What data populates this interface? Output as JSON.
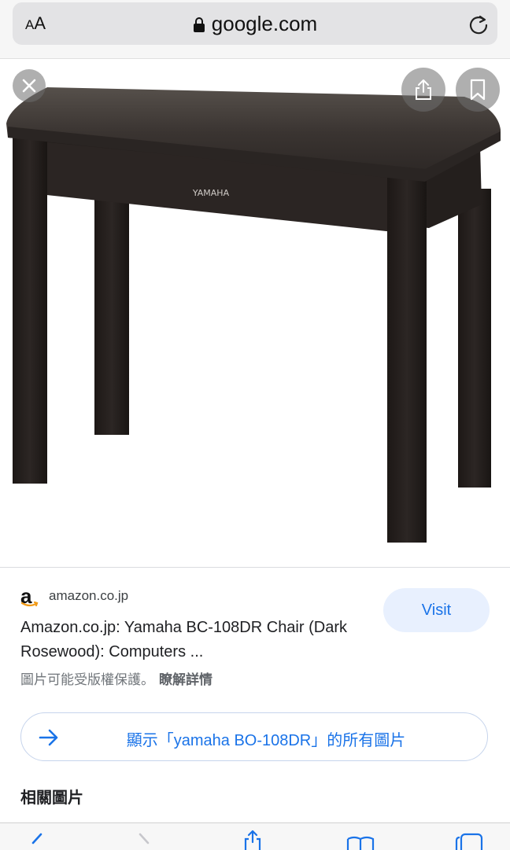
{
  "browser": {
    "text_size_label_small": "A",
    "text_size_label_large": "A",
    "url": "google.com"
  },
  "image_viewer": {
    "product_image": "yamaha-piano-bench",
    "brand_text": "YAMAHA"
  },
  "result": {
    "source_logo": "a",
    "source_domain": "amazon.co.jp",
    "title": "Amazon.co.jp: Yamaha BC-108DR Chair (Dark Rosewood): Computers ...",
    "copyright_notice": "圖片可能受版權保護。",
    "learn_more": "瞭解詳情",
    "visit_label": "Visit"
  },
  "show_all": {
    "label": "顯示「yamaha BO-108DR」的所有圖片"
  },
  "related": {
    "heading": "相關圖片"
  },
  "colors": {
    "accent": "#1a73e8",
    "visit_bg": "#e8f0fe",
    "bench": "#2a2422"
  },
  "icons": [
    "lock-icon",
    "reload-icon",
    "close-icon",
    "share-icon",
    "bookmark-icon",
    "arrow-right-icon",
    "back-icon",
    "forward-icon",
    "share-toolbar-icon",
    "bookmarks-icon",
    "tabs-icon"
  ]
}
